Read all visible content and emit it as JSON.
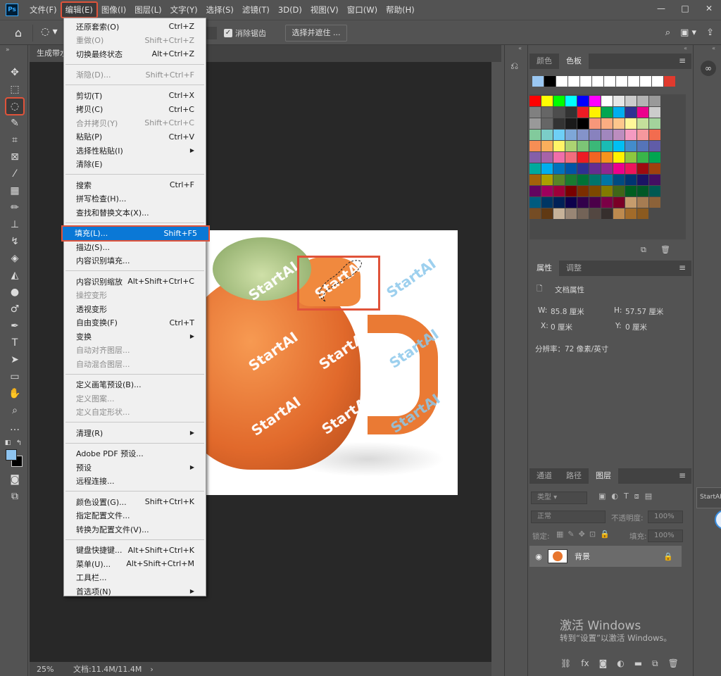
{
  "app": {
    "logo": "Ps",
    "menus": [
      "文件(F)",
      "编辑(E)",
      "图像(I)",
      "图层(L)",
      "文字(Y)",
      "选择(S)",
      "滤镜(T)",
      "3D(D)",
      "视图(V)",
      "窗口(W)",
      "帮助(H)"
    ],
    "window_controls": [
      "—",
      "□",
      "✕"
    ]
  },
  "options": {
    "antialias_label": "消除锯齿",
    "select_mask_label": "选择并遮住 ..."
  },
  "document": {
    "tab_label": "生成带水",
    "watermark_text": "StartAI"
  },
  "status": {
    "zoom": "25%",
    "doc_size": "文档:11.4M/11.4M",
    "arrow": "›"
  },
  "edit_menu": {
    "items": [
      {
        "label": "还原套索(O)",
        "shortcut": "Ctrl+Z",
        "disabled": false
      },
      {
        "label": "重做(O)",
        "shortcut": "Shift+Ctrl+Z",
        "disabled": true
      },
      {
        "label": "切换最终状态",
        "shortcut": "Alt+Ctrl+Z",
        "disabled": false
      },
      {
        "label": "渐隐(D)...",
        "shortcut": "Shift+Ctrl+F",
        "disabled": true
      },
      {
        "label": "剪切(T)",
        "shortcut": "Ctrl+X",
        "disabled": false
      },
      {
        "label": "拷贝(C)",
        "shortcut": "Ctrl+C",
        "disabled": false
      },
      {
        "label": "合并拷贝(Y)",
        "shortcut": "Shift+Ctrl+C",
        "disabled": true
      },
      {
        "label": "粘贴(P)",
        "shortcut": "Ctrl+V",
        "disabled": false
      },
      {
        "label": "选择性粘贴(I)",
        "shortcut": "",
        "disabled": false,
        "submenu": true
      },
      {
        "label": "清除(E)",
        "shortcut": "",
        "disabled": false
      },
      {
        "label": "搜索",
        "shortcut": "Ctrl+F",
        "disabled": false
      },
      {
        "label": "拼写检查(H)...",
        "shortcut": "",
        "disabled": false
      },
      {
        "label": "查找和替换文本(X)...",
        "shortcut": "",
        "disabled": false
      },
      {
        "label": "填充(L)...",
        "shortcut": "Shift+F5",
        "disabled": false,
        "highlight": true
      },
      {
        "label": "描边(S)...",
        "shortcut": "",
        "disabled": false
      },
      {
        "label": "内容识别填充...",
        "shortcut": "",
        "disabled": false
      },
      {
        "label": "内容识别缩放",
        "shortcut": "Alt+Shift+Ctrl+C",
        "disabled": false
      },
      {
        "label": "操控变形",
        "shortcut": "",
        "disabled": true
      },
      {
        "label": "透视变形",
        "shortcut": "",
        "disabled": false
      },
      {
        "label": "自由变换(F)",
        "shortcut": "Ctrl+T",
        "disabled": false
      },
      {
        "label": "变换",
        "shortcut": "",
        "disabled": false,
        "submenu": true
      },
      {
        "label": "自动对齐图层...",
        "shortcut": "",
        "disabled": true
      },
      {
        "label": "自动混合图层...",
        "shortcut": "",
        "disabled": true
      },
      {
        "label": "定义画笔预设(B)...",
        "shortcut": "",
        "disabled": false
      },
      {
        "label": "定义图案...",
        "shortcut": "",
        "disabled": true
      },
      {
        "label": "定义自定形状...",
        "shortcut": "",
        "disabled": true
      },
      {
        "label": "清理(R)",
        "shortcut": "",
        "disabled": false,
        "submenu": true
      },
      {
        "label": "Adobe PDF 预设...",
        "shortcut": "",
        "disabled": false
      },
      {
        "label": "预设",
        "shortcut": "",
        "disabled": false,
        "submenu": true
      },
      {
        "label": "远程连接...",
        "shortcut": "",
        "disabled": false
      },
      {
        "label": "颜色设置(G)...",
        "shortcut": "Shift+Ctrl+K",
        "disabled": false
      },
      {
        "label": "指定配置文件...",
        "shortcut": "",
        "disabled": false
      },
      {
        "label": "转换为配置文件(V)...",
        "shortcut": "",
        "disabled": false
      },
      {
        "label": "键盘快捷键...",
        "shortcut": "Alt+Shift+Ctrl+K",
        "disabled": false
      },
      {
        "label": "菜单(U)...",
        "shortcut": "Alt+Shift+Ctrl+M",
        "disabled": false
      },
      {
        "label": "工具栏...",
        "shortcut": "",
        "disabled": false
      },
      {
        "label": "首选项(N)",
        "shortcut": "",
        "disabled": false,
        "submenu": true
      }
    ]
  },
  "panels": {
    "swatch_tabs": [
      "颜色",
      "色板"
    ],
    "props_tabs": [
      "属性",
      "调整"
    ],
    "doc_props_title": "文档属性",
    "w_label": "W:",
    "w_value": "85.8 厘米",
    "h_label": "H:",
    "h_value": "57.57 厘米",
    "x_label": "X:",
    "x_value": "0 厘米",
    "y_label": "Y:",
    "y_value": "0 厘米",
    "resolution": "分辨率：72 像素/英寸",
    "layer_tabs": [
      "通道",
      "路径",
      "图层"
    ],
    "filter_kind": "类型",
    "blend_mode": "正常",
    "opacity_label": "不透明度:",
    "opacity_value": "100%",
    "lock_label": "锁定:",
    "fill_label": "填充:",
    "fill_value": "100%",
    "layer_name": "背景",
    "activate_title": "激活 Windows",
    "activate_sub": "转到“设置”以激活 Windows。",
    "flyout_text": "StartAI"
  },
  "colors": {
    "accent_red": "#e0533a",
    "highlight_blue": "#0a78d6",
    "recent_swatches": [
      "#9ac7f2",
      "#000000",
      "#ffffff",
      "#ffffff",
      "#ffffff",
      "#ffffff",
      "#ffffff",
      "#ffffff",
      "#ffffff",
      "#ffffff",
      "#ffffff",
      "#e03a2e"
    ],
    "swatches": [
      "#ff0000",
      "#ffff00",
      "#00ff00",
      "#00ffff",
      "#0000ff",
      "#ff00ff",
      "#ffffff",
      "#e6e6e6",
      "#cccccc",
      "#b3b3b3",
      "#999999",
      "#808080",
      "#666666",
      "#4d4d4d",
      "#333333",
      "#ed1c24",
      "#fff200",
      "#00a651",
      "#00aeef",
      "#2e3192",
      "#ec008c",
      "#cccccc",
      "#999999",
      "#666666",
      "#333333",
      "#1a1a1a",
      "#000000",
      "#f7977a",
      "#fbad82",
      "#fdc68c",
      "#fff799",
      "#c4df9b",
      "#a3d39c",
      "#82ca9c",
      "#7bcdc8",
      "#6ecff6",
      "#7ea7d8",
      "#8493ca",
      "#8882be",
      "#a187be",
      "#bc8dbf",
      "#f49ac1",
      "#f5989d",
      "#f26c4f",
      "#f68e55",
      "#fbaf5c",
      "#fff467",
      "#acd372",
      "#7cc576",
      "#3bb878",
      "#1abbb4",
      "#00bff3",
      "#438ccb",
      "#5574b9",
      "#605ca8",
      "#855fa8",
      "#a763a8",
      "#f06ea9",
      "#f26d7d",
      "#ed1c24",
      "#f26522",
      "#f7941d",
      "#fff200",
      "#8dc73f",
      "#39b54a",
      "#00a651",
      "#00a99d",
      "#00aeef",
      "#0072bc",
      "#0054a6",
      "#2e3192",
      "#662d91",
      "#92278f",
      "#ec008c",
      "#ed145b",
      "#9e0b0f",
      "#a0410d",
      "#a36209",
      "#aba000",
      "#598527",
      "#1a7b30",
      "#007236",
      "#00746b",
      "#0076a3",
      "#004b80",
      "#003471",
      "#1b1464",
      "#440e62",
      "#630460",
      "#9e005d",
      "#9e0039",
      "#790000",
      "#7b2e00",
      "#7d4900",
      "#827b00",
      "#406618",
      "#005e20",
      "#005826",
      "#005952",
      "#005b7f",
      "#003663",
      "#002157",
      "#0d004c",
      "#32004b",
      "#4b0049",
      "#7b0046",
      "#7a0026",
      "#c69c6d",
      "#a67c52",
      "#8c6239",
      "#754c24",
      "#603913",
      "#c7b299",
      "#998675",
      "#736357",
      "#534741",
      "#362f2d",
      "#bd8a4f",
      "#a26b2a",
      "#8b5a1f"
    ]
  }
}
